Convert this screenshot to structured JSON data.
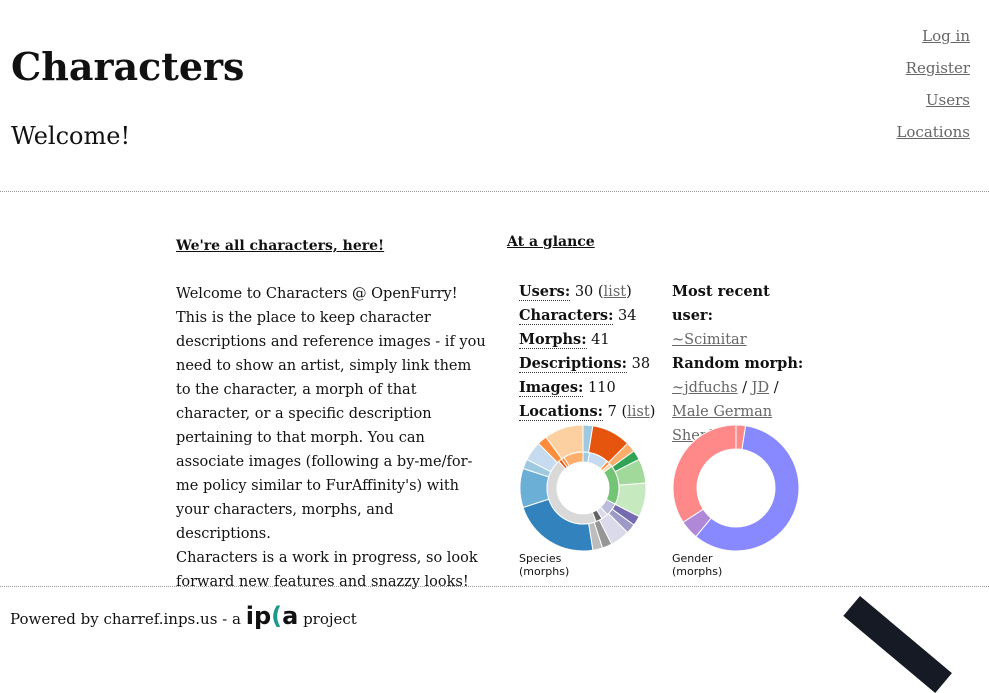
{
  "header": {
    "title": "Characters",
    "welcome": "Welcome!"
  },
  "nav": [
    "Log in",
    "Register",
    "Users",
    "Locations"
  ],
  "intro": {
    "heading": "We're all characters, here!",
    "p1": "Welcome to Characters @ OpenFurry! This is the place to keep character descriptions and reference images - if you need to show an artist, simply link them to the character, a morph of that character, or a specific description pertaining to that morph. You can associate images (following a by-me/for-me policy similar to FurAffinity's) with your characters, morphs, and descriptions.",
    "p2": "Characters is a work in progress, so look forward new features and snazzy looks!"
  },
  "glance": {
    "heading": "At a glance",
    "stats": [
      {
        "label": "Users:",
        "value": "30",
        "link": "list"
      },
      {
        "label": "Characters:",
        "value": "34"
      },
      {
        "label": "Morphs:",
        "value": "41"
      },
      {
        "label": "Descriptions:",
        "value": "38"
      },
      {
        "label": "Images:",
        "value": "110"
      },
      {
        "label": "Locations:",
        "value": "7",
        "link": "list"
      }
    ],
    "recent_label": "Most recent user:",
    "recent_user": "~Scimitar",
    "random_label": "Random morph:",
    "random_user": "~jdfuchs",
    "random_char": "JD",
    "random_morph": "Male German Shepherd"
  },
  "chart_data": [
    {
      "type": "pie",
      "title": "Species (morphs)",
      "donut": true,
      "values": [
        1,
        4,
        1,
        1,
        2.5,
        3.5,
        1,
        1,
        2,
        1,
        1,
        9,
        4,
        1,
        2,
        1,
        4
      ],
      "colors": [
        "#9ecae1",
        "#e6550d",
        "#fdae6b",
        "#31a354",
        "#a1d99b",
        "#c7e9c0",
        "#756bb1",
        "#9e9ac8",
        "#dadaeb",
        "#969696",
        "#bdbdbd",
        "#3182bd",
        "#6baed6",
        "#9ecae1",
        "#c6dbef",
        "#fd8d3c",
        "#fdd0a2"
      ],
      "inner_values": [
        1,
        3,
        0.5,
        0.5,
        6,
        2,
        1,
        1,
        15,
        0.5,
        0.5,
        3
      ],
      "inner_colors": [
        "#9ecae1",
        "#c6dbef",
        "#fd8d3c",
        "#fdd0a2",
        "#74c476",
        "#bcbddc",
        "#dadaeb",
        "#636363",
        "#d9d9d9",
        "#e6550d",
        "#fd8d3c",
        "#fdae6b"
      ]
    },
    {
      "type": "pie",
      "title": "Gender (morphs)",
      "donut": true,
      "values": [
        1,
        24,
        2,
        14
      ],
      "colors": [
        "#ff8888",
        "#8888ff",
        "#b088d8",
        "#ff8888"
      ]
    }
  ],
  "footer": {
    "text": "Powered by charref.inps.us - a",
    "logo": "inps",
    "suffix": "project"
  }
}
